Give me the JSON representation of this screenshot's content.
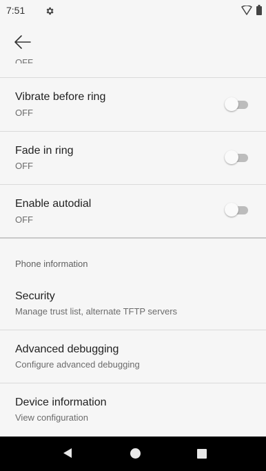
{
  "status_bar": {
    "time": "7:51",
    "icons": [
      "gear-icon",
      "wifi-icon",
      "battery-icon"
    ]
  },
  "app_bar": {
    "back_icon": "arrow-left-icon"
  },
  "partial_item": {
    "summary": "OFF"
  },
  "settings": [
    {
      "title": "Vibrate before ring",
      "summary": "OFF",
      "toggle": false
    },
    {
      "title": "Fade in ring",
      "summary": "OFF",
      "toggle": false
    },
    {
      "title": "Enable autodial",
      "summary": "OFF",
      "toggle": false
    }
  ],
  "section": {
    "header": "Phone information",
    "items": [
      {
        "title": "Security",
        "summary": "Manage trust list, alternate TFTP servers"
      },
      {
        "title": "Advanced debugging",
        "summary": "Configure advanced debugging"
      },
      {
        "title": "Device information",
        "summary": "View configuration"
      }
    ]
  },
  "nav_bar": {
    "icons": [
      "back-triangle-icon",
      "home-circle-icon",
      "recents-square-icon"
    ]
  },
  "colors": {
    "background": "#f6f6f6",
    "divider": "#dadada",
    "toggle_track_off": "#bcbcbc",
    "toggle_thumb_off": "#fafafa",
    "nav_bar": "#000000"
  }
}
